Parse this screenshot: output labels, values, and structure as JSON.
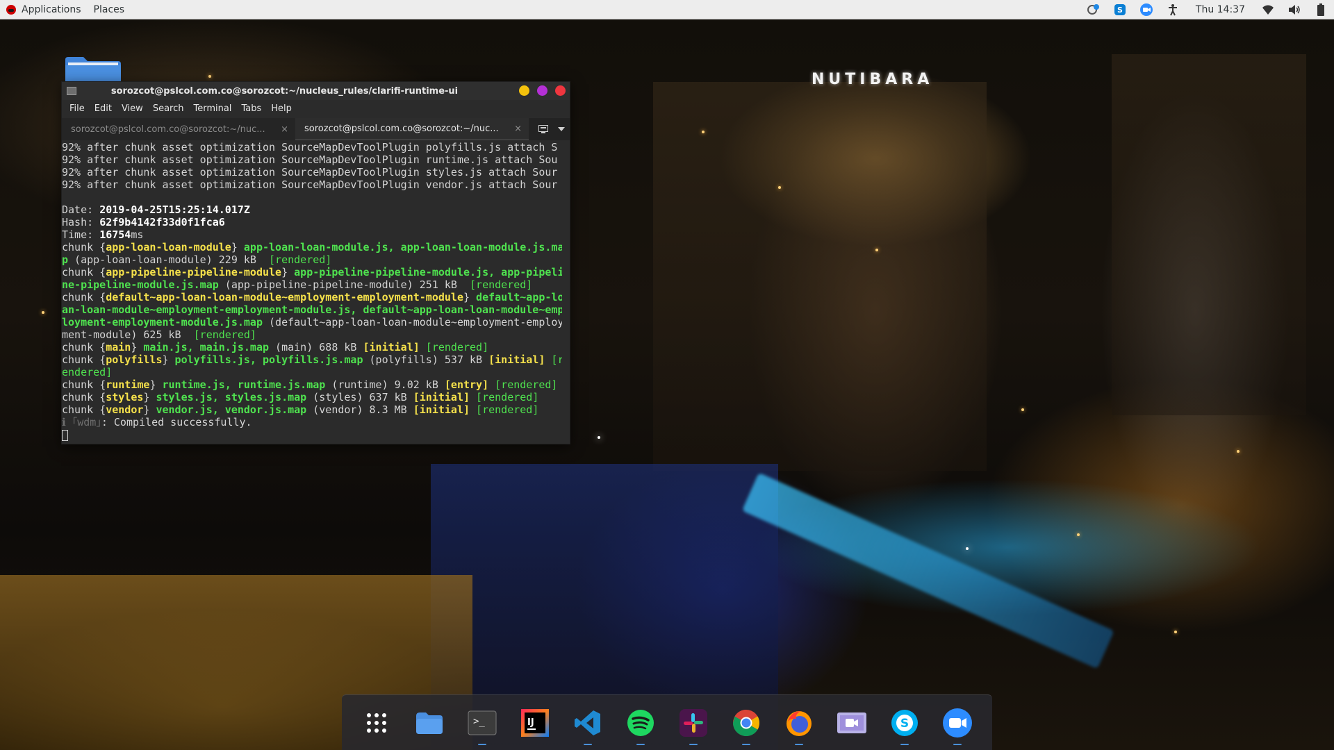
{
  "top_panel": {
    "applications_label": "Applications",
    "places_label": "Places",
    "clock": "Thu 14:37",
    "tray_icons": [
      "network-manager-icon",
      "skype-tray-icon",
      "zoom-tray-icon",
      "accessibility-icon",
      "wifi-icon",
      "volume-icon",
      "battery-icon"
    ]
  },
  "wallpaper": {
    "sign_text": "NUTIBARA"
  },
  "terminal": {
    "title": "sorozcot@pslcol.com.co@sorozcot:~/nucleus_rules/clarifi-runtime-ui",
    "menu": [
      "File",
      "Edit",
      "View",
      "Search",
      "Terminal",
      "Tabs",
      "Help"
    ],
    "tabs": [
      {
        "label": "sorozcot@pslcol.com.co@sorozcot:~/nuc...",
        "active": false
      },
      {
        "label": "sorozcot@pslcol.com.co@sorozcot:~/nuc...",
        "active": true
      }
    ],
    "close_glyph": "×",
    "output": {
      "progress_lines": [
        "92% after chunk asset optimization SourceMapDevToolPlugin polyfills.js attach S",
        "92% after chunk asset optimization SourceMapDevToolPlugin runtime.js attach Sou",
        "92% after chunk asset optimization SourceMapDevToolPlugin styles.js attach Sour",
        "92% after chunk asset optimization SourceMapDevToolPlugin vendor.js attach Sour"
      ],
      "date_label": "Date: ",
      "date_value": "2019-04-25T15:25:14.017Z",
      "hash_label": "Hash: ",
      "hash_value": "62f9b4142f33d0f1fca6",
      "time_label": "Time: ",
      "time_value": "16754",
      "time_unit": "ms",
      "chunk_word": "chunk ",
      "ob": "{",
      "cb": "}",
      "loan": {
        "name": "app-loan-loan-module",
        "files_l1": " app-loan-loan-module.js, app-loan-loan-module.js.ma",
        "files_l2": "p",
        "rest_l2": " (app-loan-loan-module) 229 kB  ",
        "rendered": "[rendered]"
      },
      "pipeline": {
        "name": "app-pipeline-pipeline-module",
        "files_l1": " app-pipeline-pipeline-module.js, app-pipeli",
        "files_l2": "ne-pipeline-module.js.map",
        "rest_l2": " (app-pipeline-pipeline-module) 251 kB  ",
        "rendered": "[rendered]"
      },
      "employment": {
        "name": "default~app-loan-loan-module~employment-employment-module",
        "files_l1": " default~app-lo",
        "files_l2": "an-loan-module~employment-employment-module.js, default~app-loan-loan-module~emp",
        "files_l3": "loyment-employment-module.js.map",
        "rest_l3": " (default~app-loan-loan-module~employment-employ",
        "rest_l4": "ment-module) 625 kB  ",
        "rendered": "[rendered]"
      },
      "main": {
        "name": "main",
        "files": " main.js, main.js.map",
        "rest": " (main) 688 kB ",
        "flag": "[initial]",
        "rendered": " [rendered]"
      },
      "polyfills": {
        "name": "polyfills",
        "files": " polyfills.js, polyfills.js.map",
        "rest": " (polyfills) 537 kB ",
        "flag": "[initial]",
        "rendered_l1": " [r",
        "rendered_l2": "endered]"
      },
      "runtime": {
        "name": "runtime",
        "files": " runtime.js, runtime.js.map",
        "rest": " (runtime) 9.02 kB ",
        "flag": "[entry]",
        "rendered": " [rendered]"
      },
      "styles": {
        "name": "styles",
        "files": " styles.js, styles.js.map",
        "rest": " (styles) 637 kB ",
        "flag": "[initial]",
        "rendered": " [rendered]"
      },
      "vendor": {
        "name": "vendor",
        "files": " vendor.js, vendor.js.map",
        "rest": " (vendor) 8.3 MB ",
        "flag": "[initial]",
        "rendered": " [rendered]"
      },
      "wdm_prefix": "ℹ ｢wdm｣",
      "wdm_message": ": Compiled successfully."
    }
  },
  "dock": {
    "items": [
      {
        "name": "show-applications",
        "running": false
      },
      {
        "name": "files",
        "running": false
      },
      {
        "name": "terminal",
        "running": true
      },
      {
        "name": "intellij-idea",
        "running": false
      },
      {
        "name": "visual-studio-code",
        "running": true
      },
      {
        "name": "spotify",
        "running": true
      },
      {
        "name": "slack",
        "running": true
      },
      {
        "name": "google-chrome",
        "running": true
      },
      {
        "name": "firefox",
        "running": true
      },
      {
        "name": "screen-recorder",
        "running": false
      },
      {
        "name": "skype",
        "running": true
      },
      {
        "name": "zoom",
        "running": true
      }
    ],
    "terminal_glyph": ">_",
    "intellij_glyph": "IJ"
  },
  "colors": {
    "terminal_bg": "#2b2b2b",
    "term_green": "#4fe24f",
    "term_yellow": "#f5e14b",
    "dock_running": "#4a90d9"
  }
}
